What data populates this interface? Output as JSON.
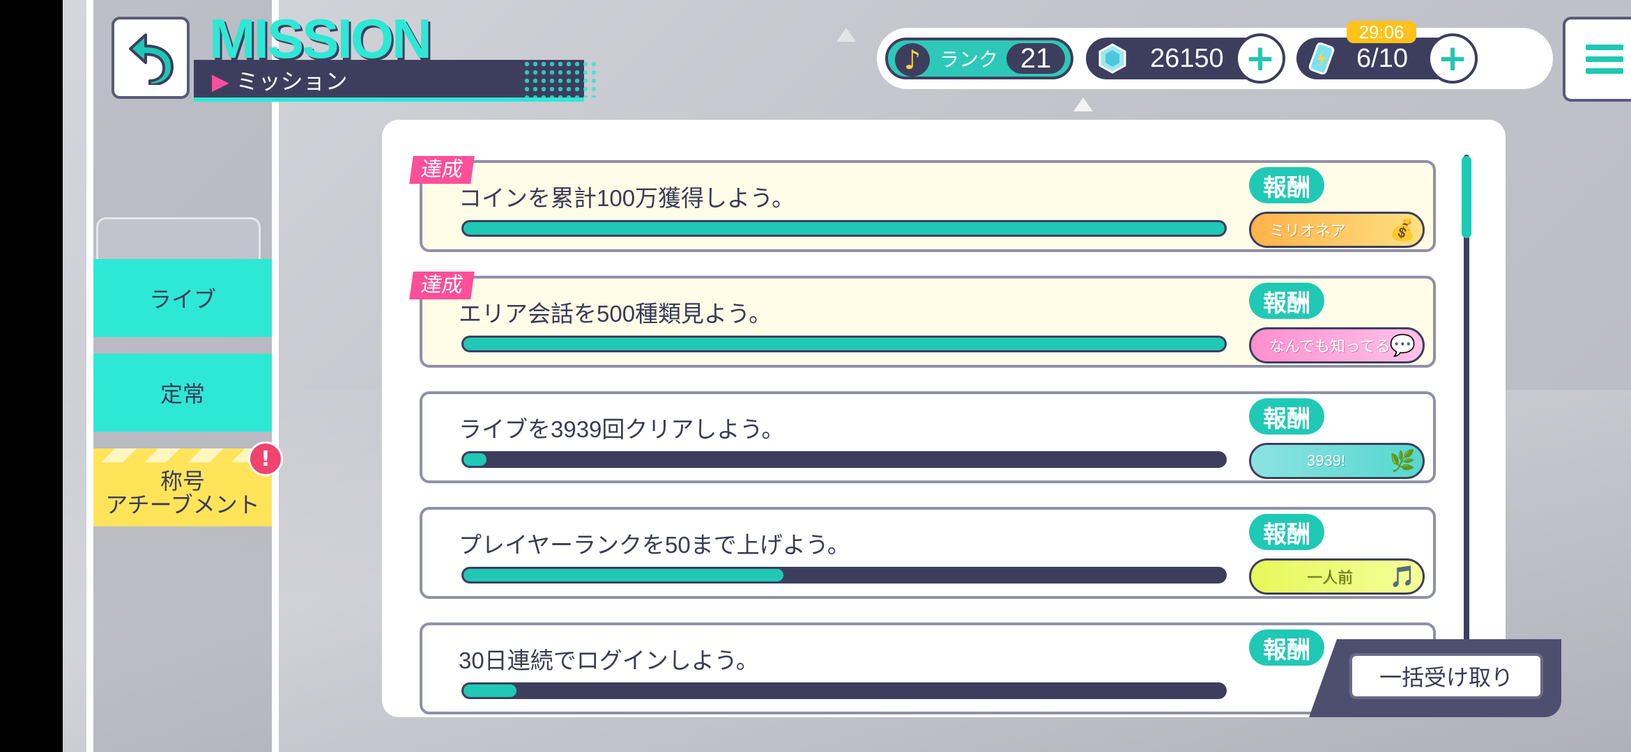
{
  "header": {
    "title_en": "MISSION",
    "title_jp": "ミッション"
  },
  "sidebar": {
    "items": [
      {
        "label": "ライブ"
      },
      {
        "label": "定常"
      },
      {
        "label": "称号\nアチーブメント"
      }
    ],
    "alert": "!"
  },
  "status": {
    "rank_label": "ランク",
    "rank_value": "21",
    "gems": "26150",
    "energy": "6/10",
    "energy_timer": "29:06",
    "plus": "+"
  },
  "missions": [
    {
      "title": "コインを累計100万獲得しよう。",
      "achieved_label": "達成",
      "reward_label": "報酬",
      "reward_badge": "ミリオネア",
      "progress": 1.0
    },
    {
      "title": "エリア会話を500種類見よう。",
      "achieved_label": "達成",
      "reward_label": "報酬",
      "reward_badge": "なんでも知ってる",
      "progress": 1.0
    },
    {
      "title": "ライブを3939回クリアしよう。",
      "achieved_label": "",
      "reward_label": "報酬",
      "reward_badge": "3939!",
      "progress": 0.03
    },
    {
      "title": "プレイヤーランクを50まで上げよう。",
      "achieved_label": "",
      "reward_label": "報酬",
      "reward_badge": "一人前",
      "progress": 0.42
    },
    {
      "title": "30日連続でログインしよう。",
      "achieved_label": "",
      "reward_label": "報酬",
      "reward_badge": "",
      "progress": 0.07
    }
  ],
  "bulk_receive": "一括受け取り",
  "colors": {
    "accent": "#2ee8d6",
    "dark": "#3d3e5e",
    "achieved_tag": "#ff4f9a",
    "title_badge": "#ffe45a"
  }
}
